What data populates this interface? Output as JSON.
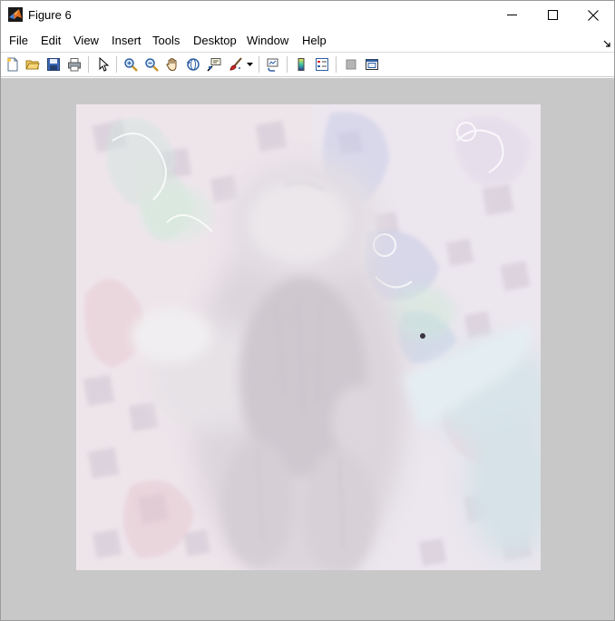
{
  "window": {
    "title": "Figure 6",
    "app_icon": "matlab-icon",
    "controls": [
      "minimize-icon",
      "maximize-icon",
      "close-icon"
    ]
  },
  "menubar": {
    "items": [
      "File",
      "Edit",
      "View",
      "Insert",
      "Tools",
      "Desktop",
      "Window",
      "Help"
    ],
    "overflow_icon": "chevron-corner-icon"
  },
  "toolbar": {
    "buttons": [
      {
        "name": "new-figure",
        "icon": "new-file-icon"
      },
      {
        "name": "open-file",
        "icon": "open-folder-icon"
      },
      {
        "name": "save-figure",
        "icon": "save-icon"
      },
      {
        "name": "print-figure",
        "icon": "print-icon"
      },
      {
        "name": "edit-plot",
        "icon": "pointer-icon"
      },
      {
        "name": "zoom-in",
        "icon": "zoom-in-icon"
      },
      {
        "name": "zoom-out",
        "icon": "zoom-out-icon"
      },
      {
        "name": "pan",
        "icon": "hand-icon"
      },
      {
        "name": "rotate-3d",
        "icon": "rotate-icon"
      },
      {
        "name": "data-cursor",
        "icon": "data-cursor-icon"
      },
      {
        "name": "brush",
        "icon": "brush-icon"
      },
      {
        "name": "link-plot",
        "icon": "link-icon"
      },
      {
        "name": "insert-colorbar",
        "icon": "colorbar-icon"
      },
      {
        "name": "insert-legend",
        "icon": "legend-icon"
      },
      {
        "name": "hide-plot-tools",
        "icon": "hide-tools-icon"
      },
      {
        "name": "show-plot-tools",
        "icon": "show-tools-icon"
      }
    ]
  },
  "figure": {
    "background_color": "#c8c8c8",
    "image_content": "washed-out photo of a fluffy kitten lying on a patterned blanket"
  }
}
